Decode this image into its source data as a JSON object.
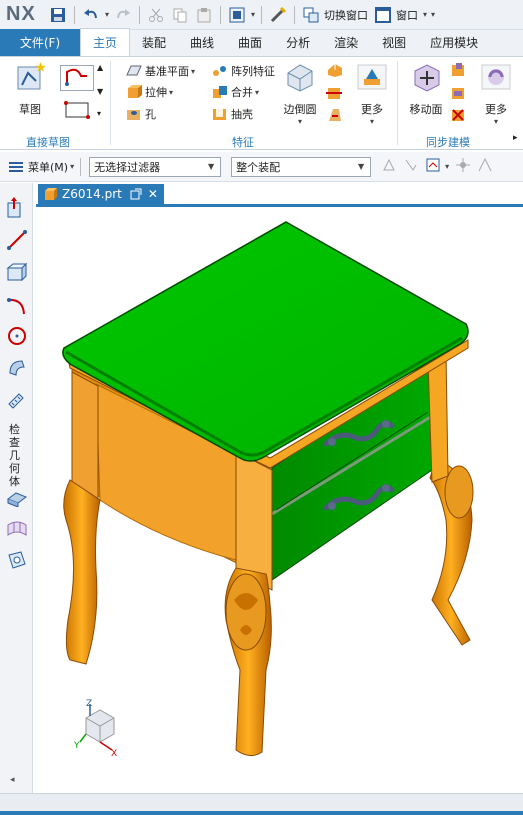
{
  "app": {
    "logo": "NX"
  },
  "quick_access": {
    "switch_window": "切换窗口",
    "window": "窗口"
  },
  "tabs": {
    "file": "文件(F)",
    "items": [
      "主页",
      "装配",
      "曲线",
      "曲面",
      "分析",
      "渲染",
      "视图",
      "应用模块"
    ],
    "active": "主页"
  },
  "ribbon": {
    "sketch": "草图",
    "datum_plane": "基准平面",
    "pattern_feature": "阵列特征",
    "extrude": "拉伸",
    "unite": "合并",
    "hole": "孔",
    "shell": "抽壳",
    "edge_blend": "边倒圆",
    "more1": "更多",
    "move_face": "移动面",
    "more2": "更多",
    "groups": {
      "direct_sketch": "直接草图",
      "feature": "特征",
      "sync_modeling": "同步建模"
    }
  },
  "toolbar": {
    "menu": "菜单(M)",
    "filter": "无选择过滤器",
    "scope": "整个装配"
  },
  "resource_bar": {
    "vertical_label": "检查几何体"
  },
  "document": {
    "tab_name": "Z6014.prt"
  },
  "colors": {
    "accent": "#2a7ab8",
    "top": "#00b400",
    "body": "#f5a623"
  }
}
